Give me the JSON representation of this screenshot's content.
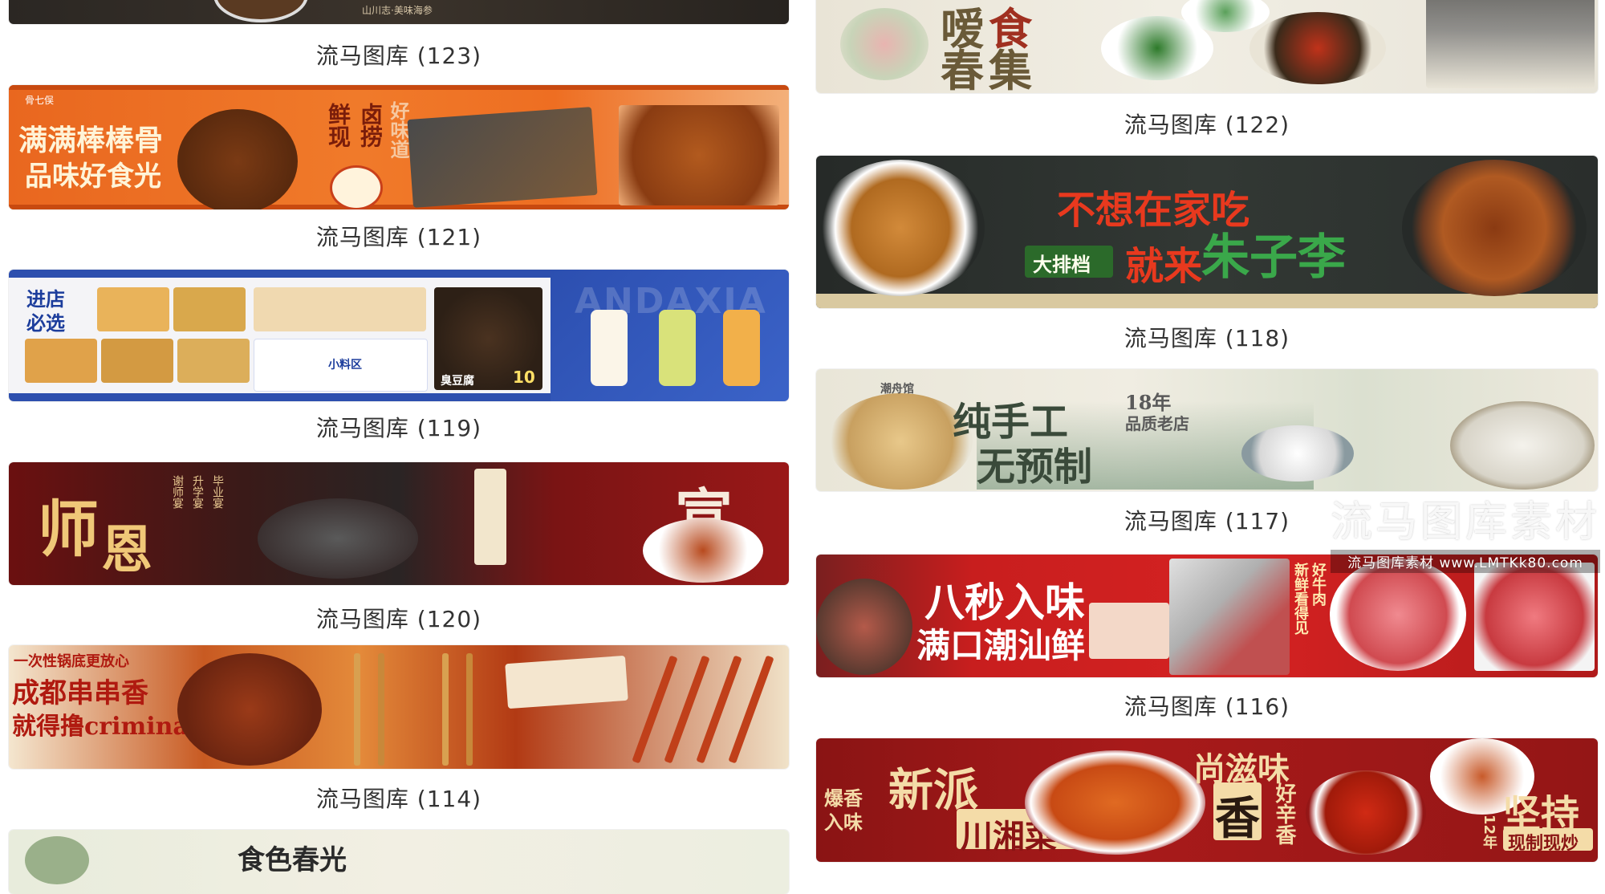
{
  "gallery": {
    "left": [
      {
        "caption": "流马图库 (123)",
        "texts": [
          "山川志·美味海参"
        ]
      },
      {
        "caption": "流马图库 (121)",
        "texts": [
          "满满棒棒骨",
          "品味好食光",
          "鲜现",
          "卤捞",
          "好味道",
          "骨七俣"
        ]
      },
      {
        "caption": "流马图库 (119)",
        "texts": [
          "进店必选",
          "小料区",
          "臭豆腐",
          "ANDAXIA",
          "10"
        ]
      },
      {
        "caption": "流马图库 (120)",
        "texts": [
          "师",
          "恩",
          "宣",
          "谢师宴",
          "升学宴",
          "毕业宴"
        ]
      },
      {
        "caption": "流马图库 (114)",
        "texts": [
          "一次性锅底更放心",
          "成都串串香",
          "就得撸criminal"
        ]
      },
      {
        "caption": "",
        "texts": [
          "食色春光"
        ]
      }
    ],
    "right": [
      {
        "caption": "",
        "texts": [
          "嗳",
          "春",
          "食",
          "集"
        ]
      },
      {
        "caption": "流马图库 (122)",
        "texts": []
      },
      {
        "caption": "流马图库 (118)",
        "texts": [
          "不想在家吃",
          "就来",
          "朱子李",
          "大排档"
        ]
      },
      {
        "caption": "流马图库 (117)",
        "texts": [
          "纯手工",
          "无预制",
          "18年",
          "品质老店",
          "潮舟馆"
        ]
      },
      {
        "caption": "流马图库 (116)",
        "texts": [
          "八秒入味",
          "满口潮汕鲜",
          "好牛肉",
          "新鲜看得见"
        ]
      },
      {
        "caption": "",
        "texts": [
          "新派",
          "川湘菜",
          "爆香入味",
          "尚滋味",
          "香",
          "好辛香",
          "坚持",
          "现制现炒",
          "12年"
        ]
      }
    ]
  },
  "watermark": {
    "title": "流马图库素材",
    "subtitle": "流马图库素材 www.LMTKk80.com"
  },
  "colors": {
    "caption_text": "#333333",
    "page_bg": "#ffffff"
  }
}
